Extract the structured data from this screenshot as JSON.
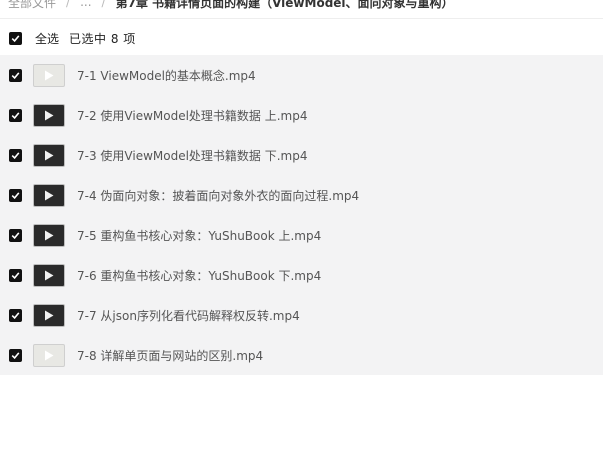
{
  "breadcrumb": {
    "root": "全部文件",
    "ellipsis": "...",
    "separator": "/",
    "current": "第7章 书籍详情页面的构建（ViewModel、面向对象与重构）"
  },
  "selection": {
    "select_all_label": "全选",
    "selected_text": "已选中 8 项",
    "all_checked": true
  },
  "files": [
    {
      "name": "7-1 ViewModel的基本概念.mp4",
      "thumb": "light",
      "checked": true
    },
    {
      "name": "7-2 使用ViewModel处理书籍数据 上.mp4",
      "thumb": "dark",
      "checked": true
    },
    {
      "name": "7-3 使用ViewModel处理书籍数据 下.mp4",
      "thumb": "dark",
      "checked": true
    },
    {
      "name": "7-4 伪面向对象：披着面向对象外衣的面向过程.mp4",
      "thumb": "dark",
      "checked": true
    },
    {
      "name": "7-5 重构鱼书核心对象：YuShuBook 上.mp4",
      "thumb": "dark",
      "checked": true
    },
    {
      "name": "7-6 重构鱼书核心对象：YuShuBook 下.mp4",
      "thumb": "dark",
      "checked": true
    },
    {
      "name": "7-7 从json序列化看代码解释权反转.mp4",
      "thumb": "dark",
      "checked": true
    },
    {
      "name": "7-8 详解单页面与网站的区别.mp4",
      "thumb": "light",
      "checked": true
    }
  ],
  "colors": {
    "checkbox": "#111111",
    "list_background": "#f3f3f4",
    "thumb_dark": "#2a2a2a",
    "thumb_light": "#e8e8e4"
  },
  "icons": {
    "checkbox": "check-icon",
    "thumbnail": "play-icon"
  }
}
